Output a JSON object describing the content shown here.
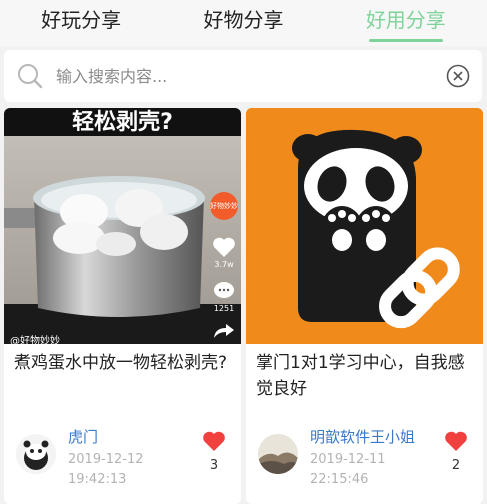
{
  "tabs": [
    {
      "label": "好玩分享",
      "active": false
    },
    {
      "label": "好物分享",
      "active": false
    },
    {
      "label": "好用分享",
      "active": true
    }
  ],
  "search": {
    "placeholder": "输入搜索内容..."
  },
  "icons": {
    "search": "search-icon",
    "clear": "clear-circle-icon",
    "like": "heart-icon",
    "comment": "comment-icon",
    "share": "share-icon"
  },
  "colors": {
    "active_tab": "#7fd39a",
    "author": "#3a79c7",
    "like": "#f0413f",
    "orange_bg": "#f08a1a"
  },
  "cards": [
    {
      "title": "煮鸡蛋水中放一物轻松剥壳?",
      "author": "虎门",
      "date": "2019-12-12",
      "time": "19:42:13",
      "likes": "3",
      "video": {
        "overlay_title": "轻松剥壳?",
        "badge": "好物妙妙",
        "like_count": "3.7w",
        "comment_count": "1251",
        "watermark": "@好物妙妙"
      }
    },
    {
      "title": "掌门1对1学习中心，自我感觉良好",
      "author": "明歆软件王小姐",
      "date": "2019-12-11",
      "time": "22:15:46",
      "likes": "2"
    }
  ]
}
